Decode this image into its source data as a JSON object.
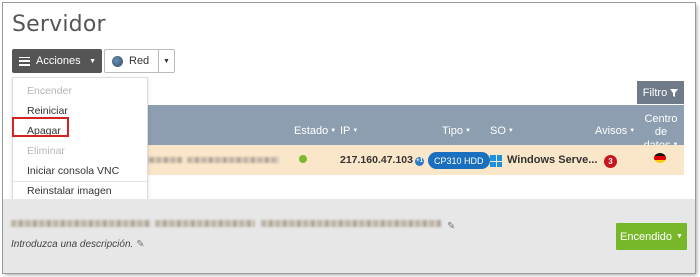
{
  "page": {
    "title": "Servidor"
  },
  "toolbar": {
    "acciones_label": "Acciones",
    "red_label": "Red"
  },
  "filter": {
    "label": "Filtro"
  },
  "table": {
    "headers": {
      "estado": "Estado",
      "ip": "IP",
      "tipo": "Tipo",
      "so": "SO",
      "avisos": "Avisos",
      "centro_line1": "Centro de",
      "centro_line2": "datos"
    },
    "row": {
      "status": "running",
      "ip": "217.160.47.103",
      "ip_badge": "+1",
      "tipo": "CP310 HDD",
      "so": "Windows Serve...",
      "avisos": "3"
    }
  },
  "dropdown": {
    "items": [
      {
        "label": "Encender",
        "disabled": true
      },
      {
        "label": "Reiniciar",
        "disabled": false
      },
      {
        "label": "Apagar",
        "disabled": false,
        "highlighted": true
      },
      {
        "label": "Eliminar",
        "disabled": true
      },
      {
        "label": "Iniciar consola VNC",
        "disabled": false
      },
      {
        "label": "Reinstalar imagen",
        "disabled": false
      }
    ]
  },
  "bottom": {
    "description_placeholder": "Introduzca una descripción.",
    "power_button": "Encendido"
  },
  "colors": {
    "accent_green": "#77b82a",
    "table_header": "#8d9eb1",
    "row_highlight": "#fae6c8",
    "tipo_badge": "#1a6fbf",
    "alert_red": "#c8141e"
  },
  "icons": {
    "acciones": "menu-list-icon",
    "red": "globe-icon",
    "filtro": "filter-icon",
    "so": "windows-logo-icon",
    "centro": "germany-flag-icon",
    "edit": "pencil-icon"
  }
}
